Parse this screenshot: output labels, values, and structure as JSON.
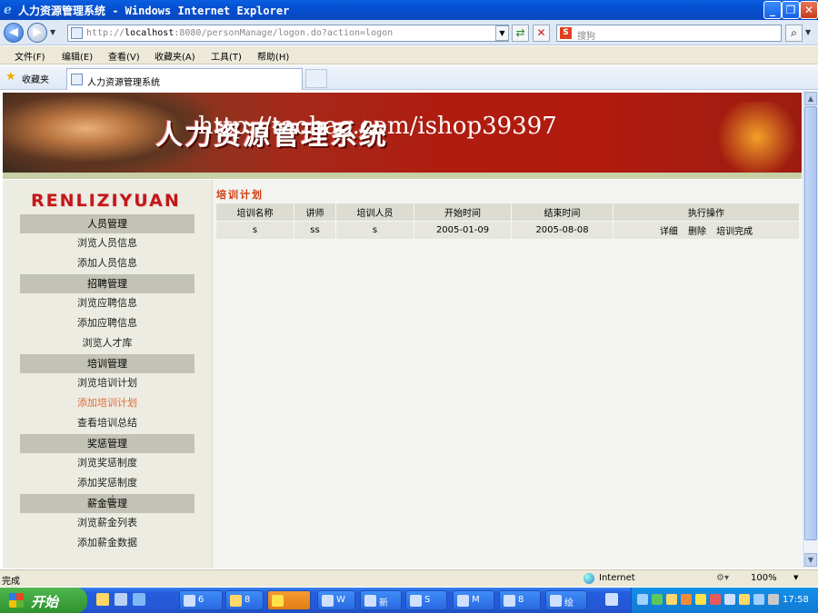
{
  "window": {
    "title": "人力资源管理系统 - Windows Internet Explorer"
  },
  "address": {
    "url_prefix": "http://",
    "host": "localhost",
    "url_rest": ":8080/personManage/logon.do?action=logon",
    "search_placeholder": "搜狗"
  },
  "menu": [
    "文件(F)",
    "编辑(E)",
    "查看(V)",
    "收藏夹(A)",
    "工具(T)",
    "帮助(H)"
  ],
  "favorites": {
    "label": "收藏夹",
    "tab_title": "人力资源管理系统"
  },
  "banner": {
    "title": "人力资源管理系统",
    "watermark": "http://taobao.com/ishop39397"
  },
  "sidebar": {
    "logo": "RENLIZIYUAN",
    "groups": [
      {
        "header": "人员管理",
        "items": [
          "浏览人员信息",
          "添加人员信息"
        ]
      },
      {
        "header": "招聘管理",
        "items": [
          "浏览应聘信息",
          "添加应聘信息",
          "浏览人才库"
        ]
      },
      {
        "header": "培训管理",
        "items": [
          "浏览培训计划",
          "添加培训计划",
          "查看培训总结"
        ]
      },
      {
        "header": "奖惩管理",
        "items": [
          "浏览奖惩制度",
          "添加奖惩制度"
        ]
      },
      {
        "header": "薪金管理",
        "items": [
          "浏览薪金列表",
          "添加薪金数据"
        ]
      }
    ]
  },
  "content": {
    "section_title": "培训计划",
    "table": {
      "headers": [
        "培训名称",
        "讲师",
        "培训人员",
        "开始时间",
        "结束时间",
        "执行操作"
      ],
      "rows": [
        {
          "name": "s",
          "teacher": "ss",
          "trainees": "s",
          "start": "2005-01-09",
          "end": "2005-08-08",
          "actions": [
            "详细",
            "删除",
            "培训完成"
          ]
        }
      ]
    }
  },
  "status": {
    "text": "完成",
    "zone": "Internet",
    "zoom": "100%"
  },
  "taskbar": {
    "start_label": "开始",
    "buttons": [
      "6",
      "8",
      "",
      "W",
      "新",
      "S",
      "M",
      "8",
      "绘"
    ],
    "clock": "17:58"
  },
  "colors": {
    "accent_red": "#d13b0f",
    "sidebar_bg": "#ecece2",
    "header_gray": "#c3c2b6"
  }
}
